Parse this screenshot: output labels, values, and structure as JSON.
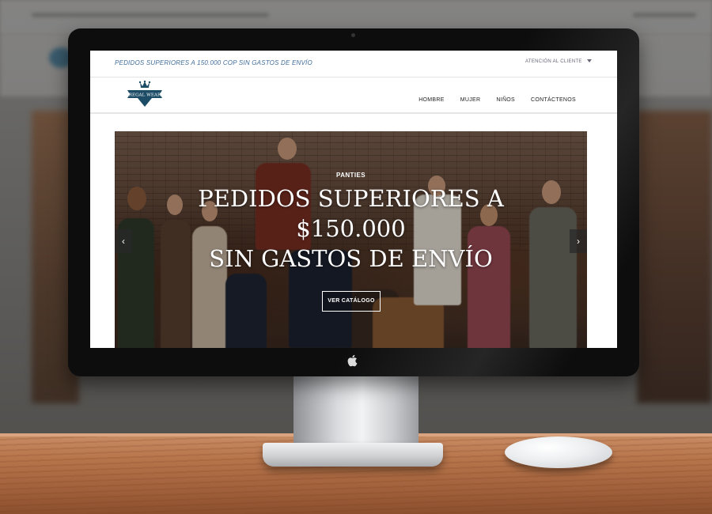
{
  "topbar": {
    "promo_text": "PEDIDOS SUPERIORES A 150.000 COP SIN GASTOS DE ENVÍO",
    "customer_service_label": "ATENCIÓN AL CLIENTE"
  },
  "brand": {
    "logo_text": "REGAL WEAR",
    "logo_color": "#1c4c66",
    "logo_icon": "crown-icon"
  },
  "nav": {
    "items": [
      "HOMBRE",
      "MUJER",
      "NIÑOS",
      "CONTÁCTENOS"
    ]
  },
  "hero": {
    "tag": "PANTIES",
    "title_line1": "PEDIDOS SUPERIORES A",
    "title_line2": "$150.000",
    "title_line3": "SIN GASTOS DE ENVÍO",
    "button_label": "VER CATÁLOGO",
    "prev_icon": "chevron-left-icon",
    "next_icon": "chevron-right-icon"
  },
  "device": {
    "logo_icon": "apple-icon"
  }
}
